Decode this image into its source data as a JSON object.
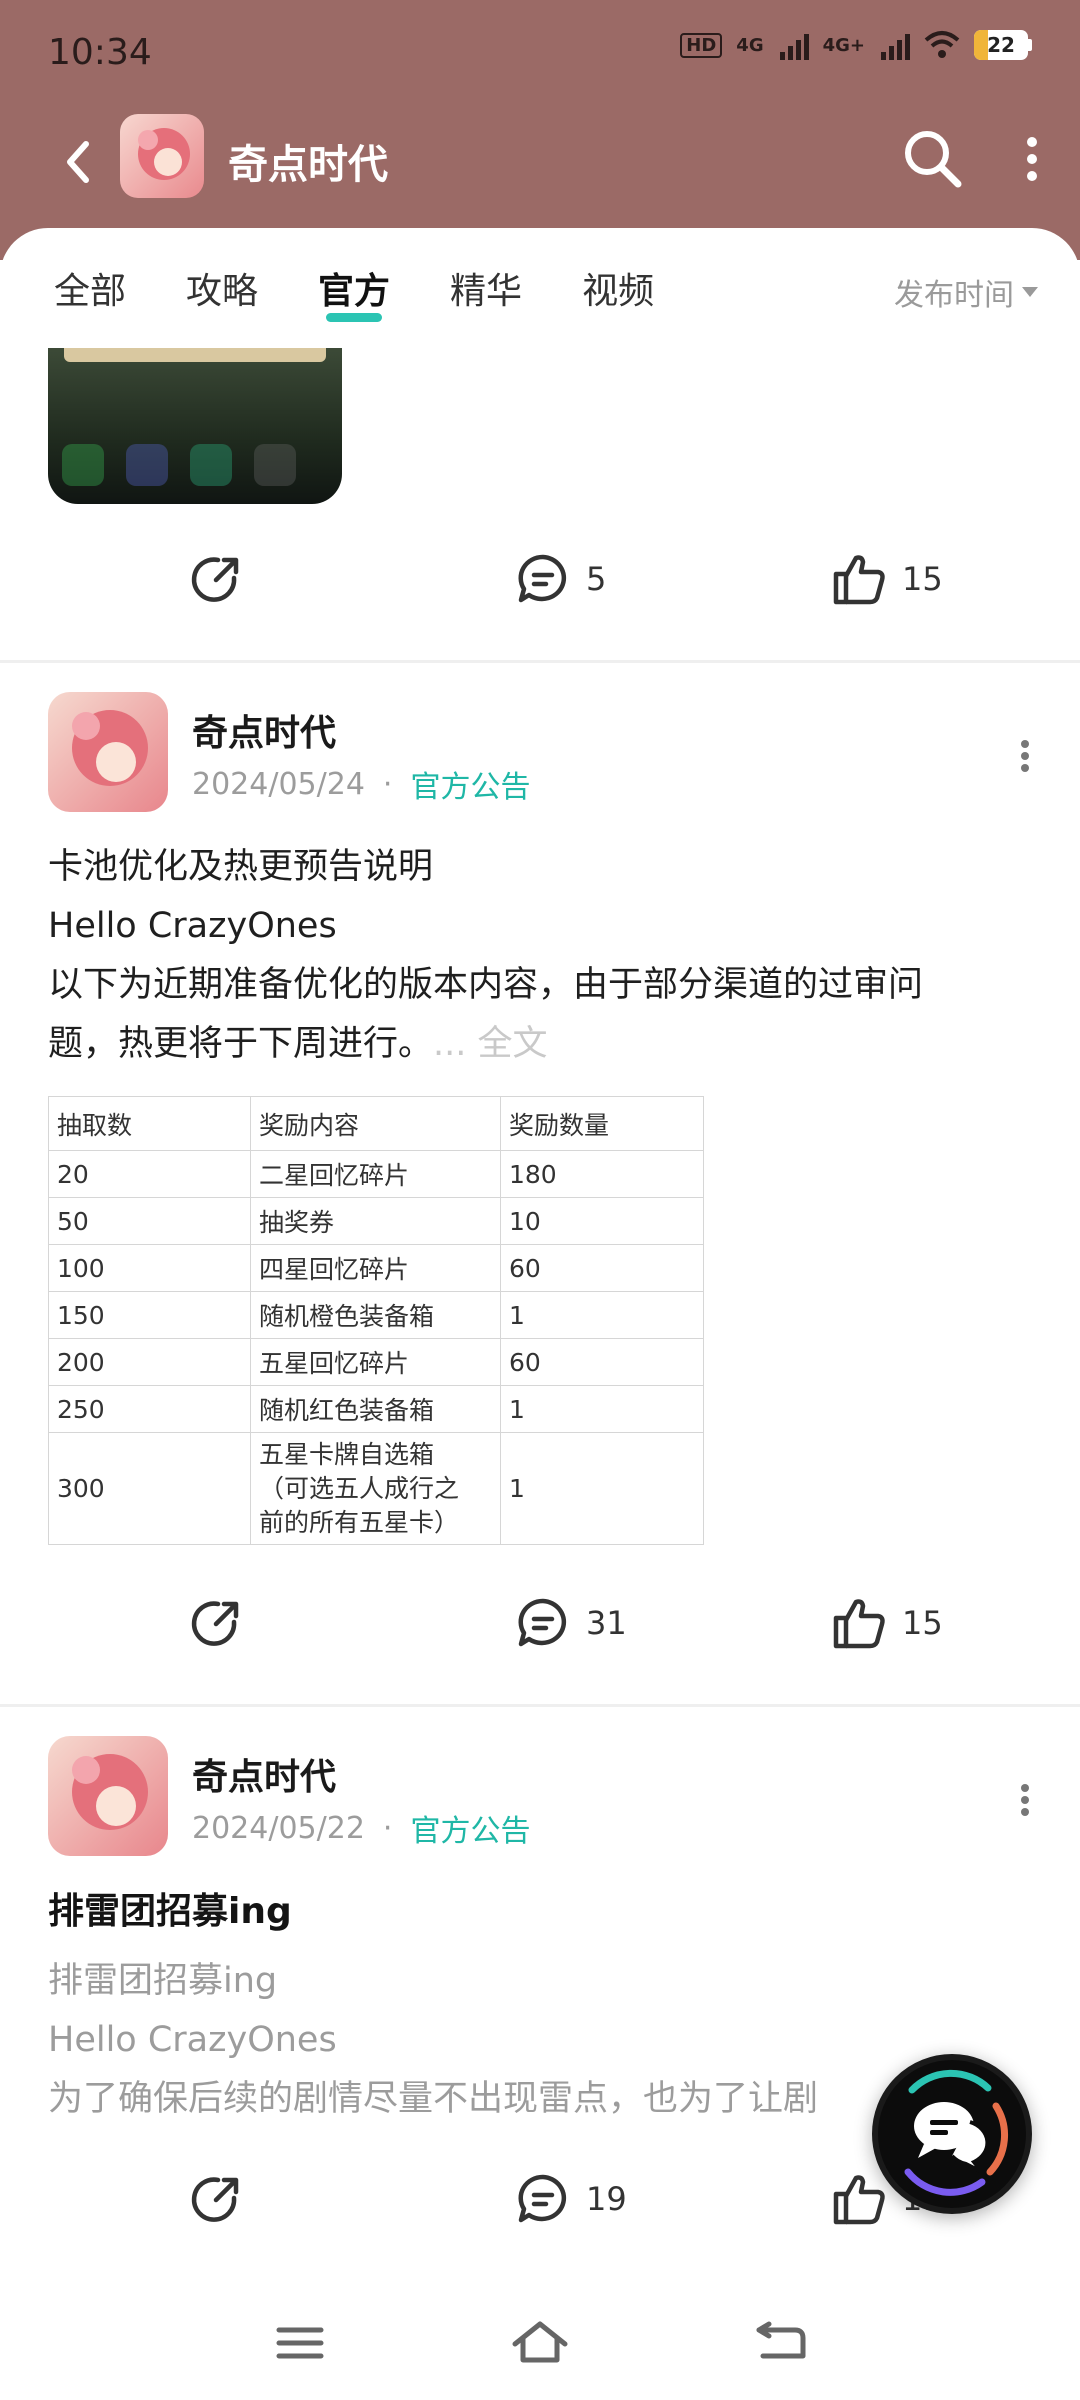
{
  "status_bar": {
    "time": "10:34",
    "hd_label": "HD",
    "net1": "4G",
    "net2": "4G+",
    "battery": "22"
  },
  "header": {
    "title": "奇点时代"
  },
  "tabs": {
    "items": [
      "全部",
      "攻略",
      "官方",
      "精华",
      "视频"
    ],
    "active_index": 2,
    "sort_label": "发布时间"
  },
  "posts": [
    {
      "id": "post-0",
      "share_count": "",
      "comment_count": "5",
      "like_count": "15"
    },
    {
      "id": "post-1",
      "author": "奇点时代",
      "date": "2024/05/24",
      "separator": "·",
      "tag": "官方公告",
      "lines": [
        "卡池优化及热更预告说明",
        "Hello CrazyOnes",
        "以下为近期准备优化的版本内容，由于部分渠道的过审问",
        "题，热更将于下周进行。"
      ],
      "more_label": "... 全文",
      "table": {
        "headers": [
          "抽取数",
          "奖励内容",
          "奖励数量"
        ],
        "rows": [
          [
            "20",
            "二星回忆碎片",
            "180"
          ],
          [
            "50",
            "抽奖券",
            "10"
          ],
          [
            "100",
            "四星回忆碎片",
            "60"
          ],
          [
            "150",
            "随机橙色装备箱",
            "1"
          ],
          [
            "200",
            "五星回忆碎片",
            "60"
          ],
          [
            "250",
            "随机红色装备箱",
            "1"
          ],
          [
            "300",
            "五星卡牌自选箱\n（可选五人成行之\n前的所有五星卡）",
            "1"
          ]
        ]
      },
      "comment_count": "31",
      "like_count": "15"
    },
    {
      "id": "post-2",
      "author": "奇点时代",
      "date": "2024/05/22",
      "separator": "·",
      "tag": "官方公告",
      "title": "排雷团招募ing",
      "lines": [
        "排雷团招募ing",
        "Hello CrazyOnes",
        "为了确保后续的剧情尽量不出现雷点，也为了让剧"
      ],
      "comment_count": "19",
      "like_count": "19"
    }
  ],
  "colors": {
    "header_bg": "#9b6a66",
    "accent": "#2bc4b3",
    "tag": "#1fb7a6"
  }
}
